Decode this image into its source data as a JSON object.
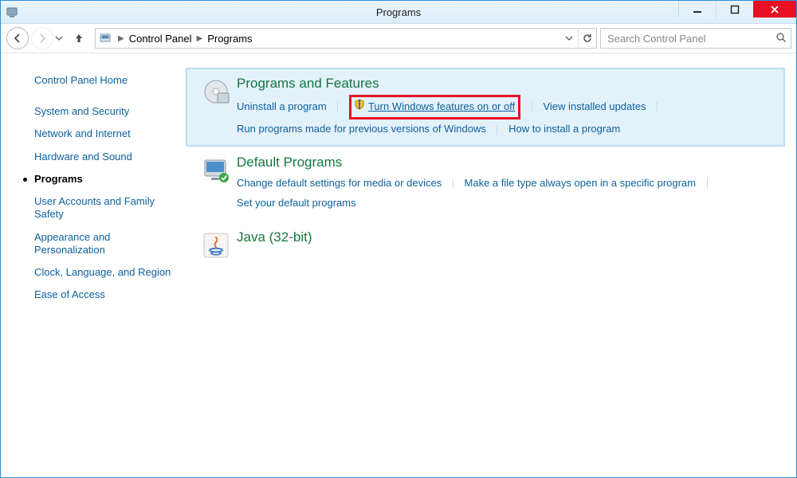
{
  "window": {
    "title": "Programs"
  },
  "breadcrumb": {
    "root": "Control Panel",
    "leaf": "Programs"
  },
  "search": {
    "placeholder": "Search Control Panel"
  },
  "sidebar": {
    "home": "Control Panel Home",
    "items": [
      {
        "label": "System and Security",
        "active": false
      },
      {
        "label": "Network and Internet",
        "active": false
      },
      {
        "label": "Hardware and Sound",
        "active": false
      },
      {
        "label": "Programs",
        "active": true
      },
      {
        "label": "User Accounts and Family Safety",
        "active": false
      },
      {
        "label": "Appearance and Personalization",
        "active": false
      },
      {
        "label": "Clock, Language, and Region",
        "active": false
      },
      {
        "label": "Ease of Access",
        "active": false
      }
    ]
  },
  "sections": {
    "programs_features": {
      "title": "Programs and Features",
      "links": {
        "uninstall": "Uninstall a program",
        "win_features": "Turn Windows features on or off",
        "view_updates": "View installed updates",
        "compat": "Run programs made for previous versions of Windows",
        "how_install": "How to install a program"
      },
      "highlighted": "win_features"
    },
    "default_programs": {
      "title": "Default Programs",
      "links": {
        "change_defaults": "Change default settings for media or devices",
        "file_type_assoc": "Make a file type always open in a specific program",
        "set_defaults": "Set your default programs"
      }
    },
    "java": {
      "title": "Java (32-bit)"
    }
  }
}
